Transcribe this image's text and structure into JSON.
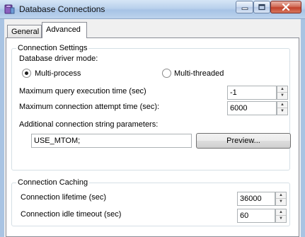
{
  "window": {
    "title": "Database Connections"
  },
  "tabs": [
    {
      "label": "General"
    },
    {
      "label": "Advanced"
    }
  ],
  "connection_settings": {
    "title": "Connection Settings",
    "driver_mode_label": "Database driver mode:",
    "radio_multiprocess": "Multi-process",
    "radio_multithreaded": "Multi-threaded",
    "selected_mode": "Multi-process",
    "max_query_label": "Maximum query execution time (sec)",
    "max_query_value": "-1",
    "max_attempt_label": "Maximum connection attempt time (sec):",
    "max_attempt_value": "6000",
    "conn_string_label": "Additional connection string parameters:",
    "conn_string_value": "USE_MTOM;",
    "preview_button": "Preview..."
  },
  "connection_caching": {
    "title": "Connection Caching",
    "lifetime_label": "Connection lifetime (sec)",
    "lifetime_value": "36000",
    "idle_label": "Connection idle timeout (sec)",
    "idle_value": "60"
  },
  "icons": {
    "app": "database-icon",
    "minimize": "minimize-icon",
    "maximize": "maximize-icon",
    "close": "close-icon"
  }
}
